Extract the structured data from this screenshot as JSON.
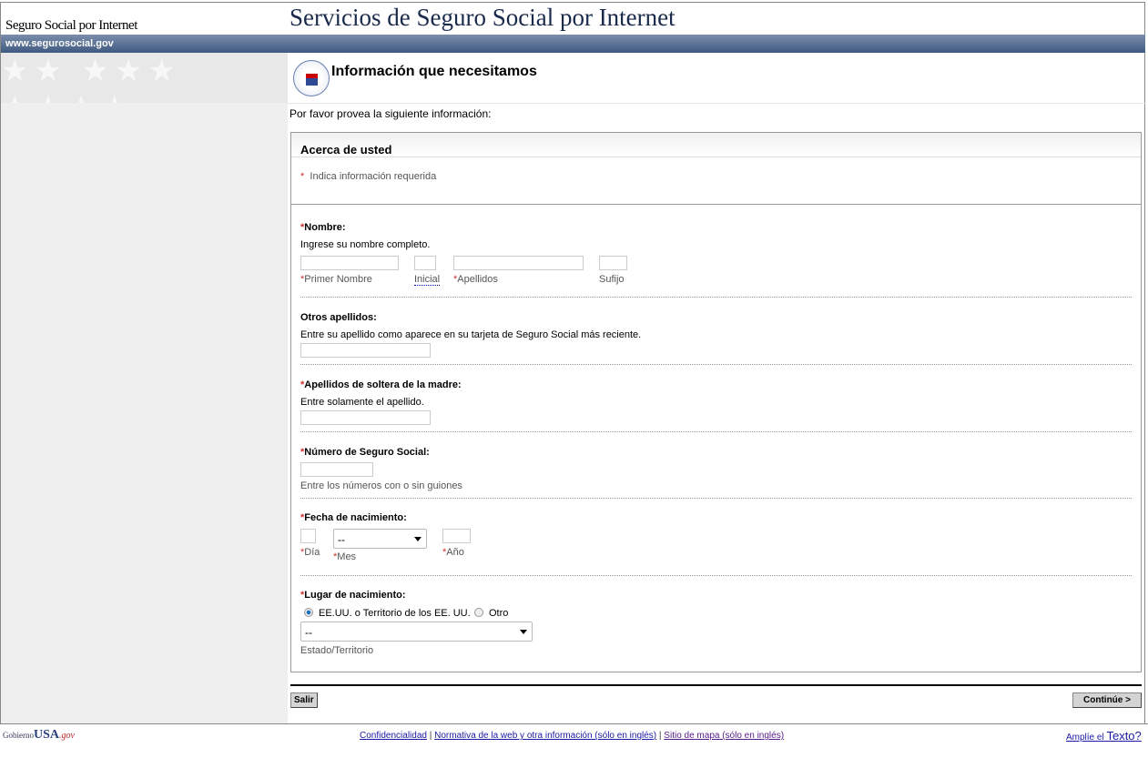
{
  "header": {
    "site_name": "Seguro Social por Internet",
    "title": "Servicios de Seguro Social por Internet",
    "url_bar": "www.segurosocial.gov"
  },
  "page": {
    "title": "Información que necesitamos",
    "intro": "Por favor provea la siguiente información:"
  },
  "form": {
    "section_title": "Acerca de usted",
    "required_note": "Indica información requerida",
    "required_mark": "*",
    "nombre": {
      "label": "Nombre:",
      "hint": "Ingrese su nombre completo.",
      "first": "Primer Nombre",
      "initial": "Inicial",
      "last": "Apellidos",
      "suffix": "Sufijo"
    },
    "otros": {
      "label": "Otros apellidos:",
      "hint": "Entre su apellido como aparece en su tarjeta de Seguro Social más reciente."
    },
    "madre": {
      "label": "Apellidos de soltera de la madre:",
      "hint": "Entre solamente el apellido."
    },
    "ssn": {
      "label": "Número de Seguro Social:",
      "hint": "Entre los números con o sin guiones"
    },
    "dob": {
      "label": "Fecha de nacimiento:",
      "day": "Día",
      "month": "Mes",
      "month_value": "--",
      "year": "Año"
    },
    "pob": {
      "label": "Lugar de nacimiento:",
      "option_us": "EE.UU. o Territorio de los EE. UU.",
      "option_other": "Otro",
      "selected": "us",
      "state_value": "--",
      "state_label": "Estado/Territorio"
    }
  },
  "buttons": {
    "exit": "Salir",
    "continue": "Continúe >"
  },
  "footer": {
    "logo": "GobiernoUSA.gov",
    "links": [
      "Confidencialidad",
      "Normativa de la web y otra información (sólo en inglés)",
      "Sitio de mapa (sólo en inglés)"
    ],
    "separator": "|",
    "enlarge_prefix": "Amplíe el",
    "enlarge_word": "Texto?"
  }
}
